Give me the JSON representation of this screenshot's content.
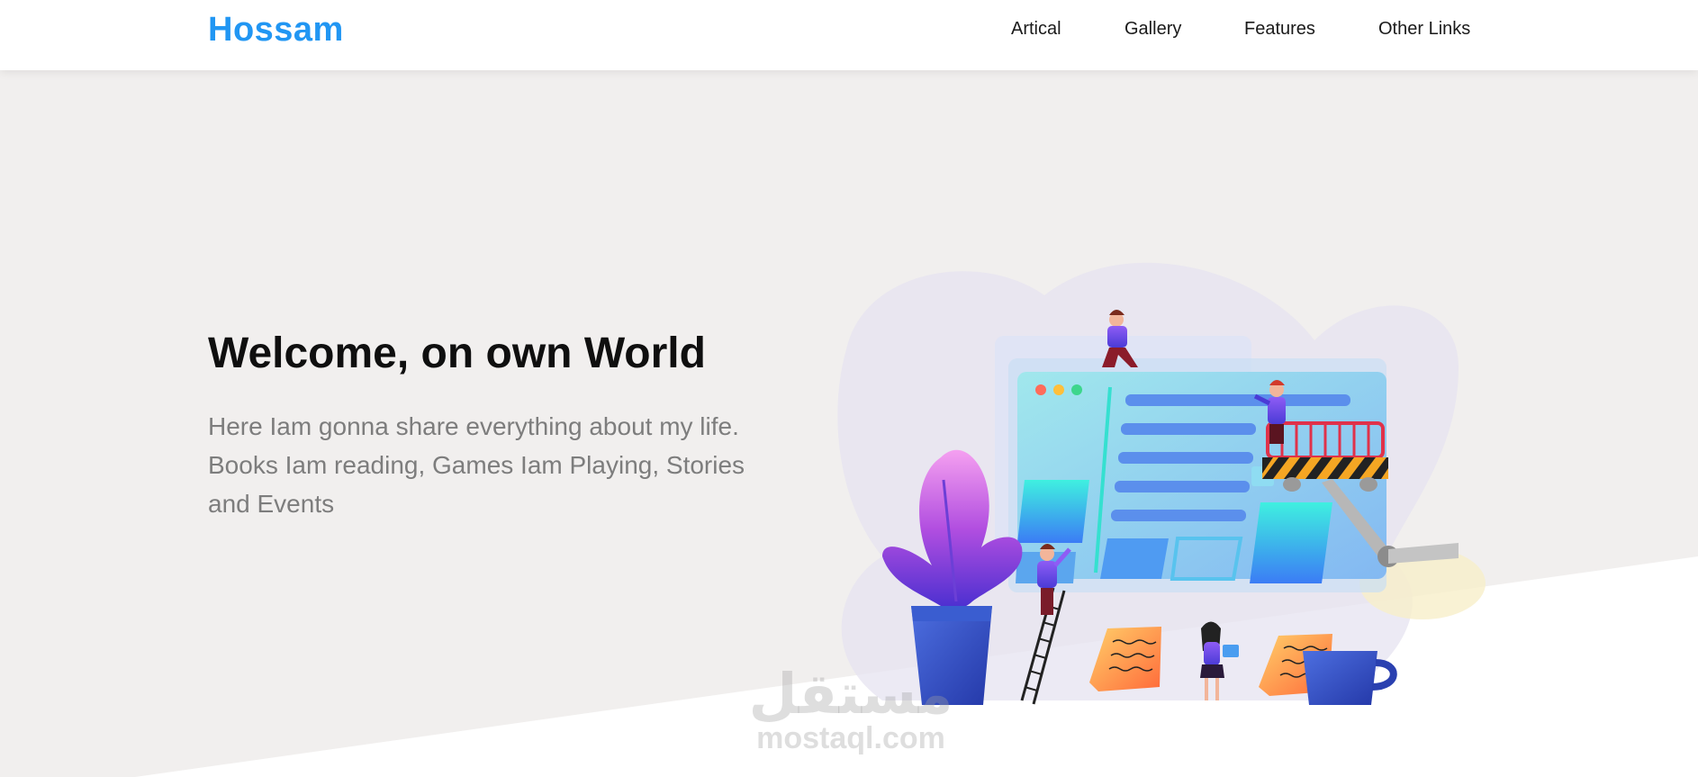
{
  "brand": {
    "name": "Hossam",
    "color": "#2196f3"
  },
  "nav": {
    "items": [
      {
        "label": "Artical"
      },
      {
        "label": "Gallery"
      },
      {
        "label": "Features"
      },
      {
        "label": "Other Links"
      }
    ]
  },
  "hero": {
    "title": "Welcome, on own World",
    "description": "Here Iam gonna share everything about my life. Books Iam reading, Games Iam Playing, Stories and Events",
    "background": "#f1efee"
  },
  "watermark": {
    "arabic": "مستقل",
    "latin": "mostaql.com"
  }
}
